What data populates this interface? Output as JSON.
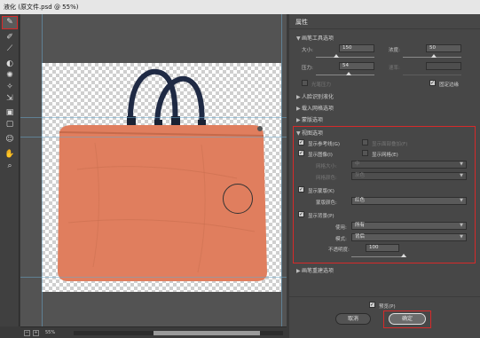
{
  "window": {
    "title": "液化 (原文件.psd @ 55%)"
  },
  "toolbar": {
    "tools": [
      "forward-warp",
      "reconstruct",
      "smooth",
      "twirl",
      "pucker",
      "bloat",
      "push-left",
      "freeze-mask",
      "thaw-mask",
      "face",
      "hand",
      "zoom"
    ]
  },
  "status": {
    "zoom": "55%"
  },
  "panel": {
    "title": "属性",
    "brush_section": "画笔工具选项",
    "size_label": "大小:",
    "size_value": "150",
    "density_label": "浓度:",
    "density_value": "50",
    "pressure_label": "压力:",
    "pressure_value": "54",
    "rate_label": "速率:",
    "rate_value": "",
    "stylus_label": "光笔压力",
    "pin_edges_label": "固定边缘",
    "face_section": "人脸识别液化",
    "load_mesh_section": "载入网格选项",
    "mask_section": "蒙版选项",
    "view_section": "视图选项",
    "show_guides_label": "显示参考线(G)",
    "show_face_overlay_label": "显示面部叠加(F)",
    "show_image_label": "显示图像(I)",
    "show_mesh_label": "显示网格(E)",
    "mesh_size_label": "网格大小:",
    "mesh_size_value": "中",
    "mesh_color_label": "网格颜色:",
    "mesh_color_value": "灰色",
    "show_mask_label": "显示蒙版(K)",
    "mask_color_label": "蒙版颜色:",
    "mask_color_value": "红色",
    "show_backdrop_label": "显示背景(P)",
    "use_label": "使用:",
    "use_value": "所有",
    "mode_label": "模式:",
    "mode_value": "背后",
    "opacity_label": "不透明度:",
    "opacity_value": "100",
    "rebuild_section": "画笔重建选项",
    "preview_label": "预览(P)",
    "cancel_label": "取消",
    "ok_label": "确定"
  },
  "colors": {
    "highlight": "#d62a2a",
    "bag": "#e07e5e",
    "handle": "#1f2a44"
  }
}
